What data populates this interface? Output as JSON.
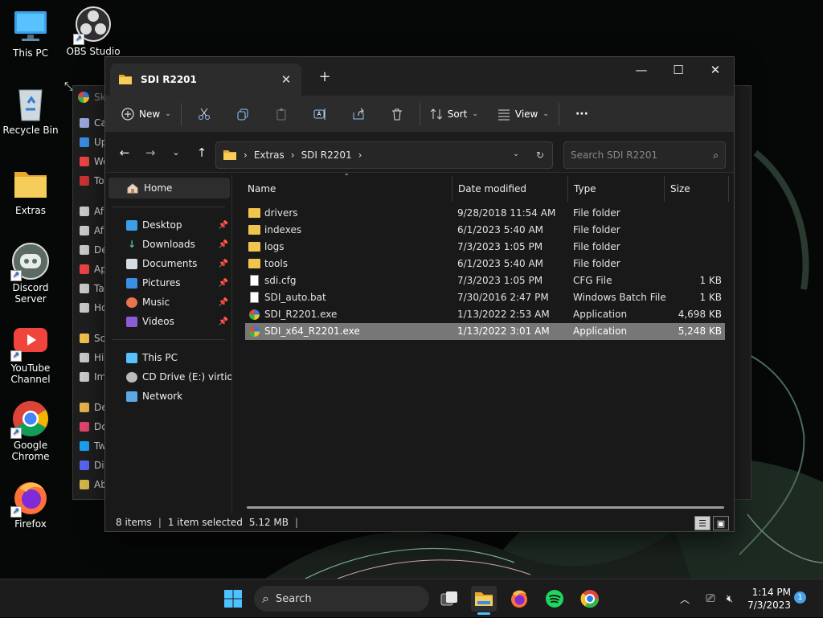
{
  "desktop": {
    "icons": [
      {
        "label": "This PC",
        "icon": "computer-icon"
      },
      {
        "label": "OBS Studio",
        "icon": "obs-icon"
      },
      {
        "label": "Recycle Bin",
        "icon": "recycle-bin-icon"
      },
      {
        "label": "Extras",
        "icon": "folder-icon"
      },
      {
        "label": "Discord Server",
        "icon": "discord-icon"
      },
      {
        "label": "YouTube Channel",
        "icon": "youtube-icon"
      },
      {
        "label": "Google Chrome",
        "icon": "chrome-icon"
      },
      {
        "label": "Firefox",
        "icon": "firefox-icon"
      }
    ]
  },
  "behind_window": {
    "title": "Sk",
    "items": [
      "Ca",
      "Up",
      "We",
      "To",
      "Af",
      "Af",
      "De",
      "Ap",
      "Ta",
      "Ho",
      "So",
      "Hi",
      "Im",
      "De",
      "Do",
      "Tw",
      "Di",
      "Ab"
    ]
  },
  "explorer": {
    "tab_title": "SDI R2201",
    "new_tab": "+",
    "controls": {
      "minimize": "—",
      "maximize": "☐",
      "close": "✕"
    },
    "toolbar": {
      "new_label": "New",
      "sort_label": "Sort",
      "view_label": "View",
      "more_label": "···"
    },
    "address": {
      "crumbs": [
        "Extras",
        "SDI R2201"
      ]
    },
    "search": {
      "placeholder": "Search SDI R2201"
    },
    "nav": {
      "home": "Home",
      "pinned": [
        "Desktop",
        "Downloads",
        "Documents",
        "Pictures",
        "Music",
        "Videos"
      ],
      "devices": [
        "This PC",
        "CD Drive (E:) virtio-w",
        "Network"
      ]
    },
    "columns": {
      "name": "Name",
      "date": "Date modified",
      "type": "Type",
      "size": "Size"
    },
    "files": [
      {
        "name": "drivers",
        "date": "9/28/2018 11:54 AM",
        "type": "File folder",
        "size": "",
        "kind": "folder"
      },
      {
        "name": "indexes",
        "date": "6/1/2023 5:40 AM",
        "type": "File folder",
        "size": "",
        "kind": "folder"
      },
      {
        "name": "logs",
        "date": "7/3/2023 1:05 PM",
        "type": "File folder",
        "size": "",
        "kind": "folder"
      },
      {
        "name": "tools",
        "date": "6/1/2023 5:40 AM",
        "type": "File folder",
        "size": "",
        "kind": "folder"
      },
      {
        "name": "sdi.cfg",
        "date": "7/3/2023 1:05 PM",
        "type": "CFG File",
        "size": "1 KB",
        "kind": "file"
      },
      {
        "name": "SDI_auto.bat",
        "date": "7/30/2016 2:47 PM",
        "type": "Windows Batch File",
        "size": "1 KB",
        "kind": "file"
      },
      {
        "name": "SDI_R2201.exe",
        "date": "1/13/2022 2:53 AM",
        "type": "Application",
        "size": "4,698 KB",
        "kind": "app"
      },
      {
        "name": "SDI_x64_R2201.exe",
        "date": "1/13/2022 3:01 AM",
        "type": "Application",
        "size": "5,248 KB",
        "kind": "app",
        "selected": true
      }
    ],
    "status": {
      "items": "8 items",
      "selected": "1 item selected",
      "size": "5.12 MB"
    }
  },
  "taskbar": {
    "search_label": "Search",
    "time": "1:14 PM",
    "date": "7/3/2023",
    "notification_count": "1"
  }
}
